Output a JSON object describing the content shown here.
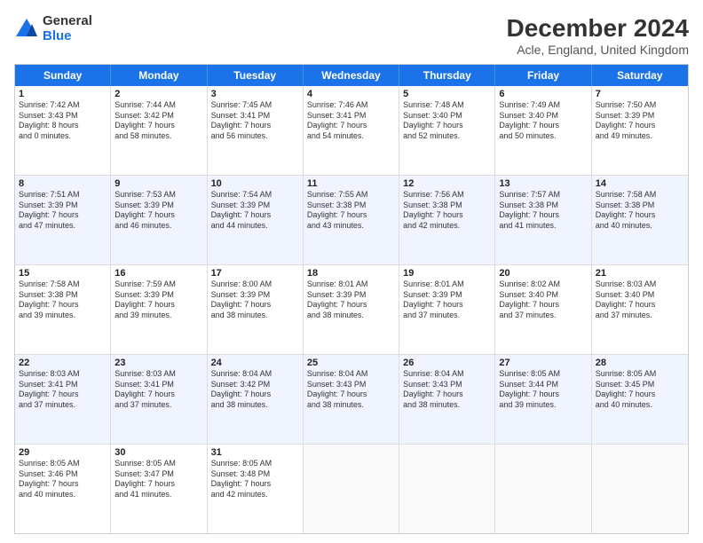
{
  "header": {
    "title": "December 2024",
    "subtitle": "Acle, England, United Kingdom",
    "logo_general": "General",
    "logo_blue": "Blue"
  },
  "days_of_week": [
    "Sunday",
    "Monday",
    "Tuesday",
    "Wednesday",
    "Thursday",
    "Friday",
    "Saturday"
  ],
  "rows": [
    {
      "alt": false,
      "cells": [
        {
          "day": "1",
          "lines": [
            "Sunrise: 7:42 AM",
            "Sunset: 3:43 PM",
            "Daylight: 8 hours",
            "and 0 minutes."
          ]
        },
        {
          "day": "2",
          "lines": [
            "Sunrise: 7:44 AM",
            "Sunset: 3:42 PM",
            "Daylight: 7 hours",
            "and 58 minutes."
          ]
        },
        {
          "day": "3",
          "lines": [
            "Sunrise: 7:45 AM",
            "Sunset: 3:41 PM",
            "Daylight: 7 hours",
            "and 56 minutes."
          ]
        },
        {
          "day": "4",
          "lines": [
            "Sunrise: 7:46 AM",
            "Sunset: 3:41 PM",
            "Daylight: 7 hours",
            "and 54 minutes."
          ]
        },
        {
          "day": "5",
          "lines": [
            "Sunrise: 7:48 AM",
            "Sunset: 3:40 PM",
            "Daylight: 7 hours",
            "and 52 minutes."
          ]
        },
        {
          "day": "6",
          "lines": [
            "Sunrise: 7:49 AM",
            "Sunset: 3:40 PM",
            "Daylight: 7 hours",
            "and 50 minutes."
          ]
        },
        {
          "day": "7",
          "lines": [
            "Sunrise: 7:50 AM",
            "Sunset: 3:39 PM",
            "Daylight: 7 hours",
            "and 49 minutes."
          ]
        }
      ]
    },
    {
      "alt": true,
      "cells": [
        {
          "day": "8",
          "lines": [
            "Sunrise: 7:51 AM",
            "Sunset: 3:39 PM",
            "Daylight: 7 hours",
            "and 47 minutes."
          ]
        },
        {
          "day": "9",
          "lines": [
            "Sunrise: 7:53 AM",
            "Sunset: 3:39 PM",
            "Daylight: 7 hours",
            "and 46 minutes."
          ]
        },
        {
          "day": "10",
          "lines": [
            "Sunrise: 7:54 AM",
            "Sunset: 3:39 PM",
            "Daylight: 7 hours",
            "and 44 minutes."
          ]
        },
        {
          "day": "11",
          "lines": [
            "Sunrise: 7:55 AM",
            "Sunset: 3:38 PM",
            "Daylight: 7 hours",
            "and 43 minutes."
          ]
        },
        {
          "day": "12",
          "lines": [
            "Sunrise: 7:56 AM",
            "Sunset: 3:38 PM",
            "Daylight: 7 hours",
            "and 42 minutes."
          ]
        },
        {
          "day": "13",
          "lines": [
            "Sunrise: 7:57 AM",
            "Sunset: 3:38 PM",
            "Daylight: 7 hours",
            "and 41 minutes."
          ]
        },
        {
          "day": "14",
          "lines": [
            "Sunrise: 7:58 AM",
            "Sunset: 3:38 PM",
            "Daylight: 7 hours",
            "and 40 minutes."
          ]
        }
      ]
    },
    {
      "alt": false,
      "cells": [
        {
          "day": "15",
          "lines": [
            "Sunrise: 7:58 AM",
            "Sunset: 3:38 PM",
            "Daylight: 7 hours",
            "and 39 minutes."
          ]
        },
        {
          "day": "16",
          "lines": [
            "Sunrise: 7:59 AM",
            "Sunset: 3:39 PM",
            "Daylight: 7 hours",
            "and 39 minutes."
          ]
        },
        {
          "day": "17",
          "lines": [
            "Sunrise: 8:00 AM",
            "Sunset: 3:39 PM",
            "Daylight: 7 hours",
            "and 38 minutes."
          ]
        },
        {
          "day": "18",
          "lines": [
            "Sunrise: 8:01 AM",
            "Sunset: 3:39 PM",
            "Daylight: 7 hours",
            "and 38 minutes."
          ]
        },
        {
          "day": "19",
          "lines": [
            "Sunrise: 8:01 AM",
            "Sunset: 3:39 PM",
            "Daylight: 7 hours",
            "and 37 minutes."
          ]
        },
        {
          "day": "20",
          "lines": [
            "Sunrise: 8:02 AM",
            "Sunset: 3:40 PM",
            "Daylight: 7 hours",
            "and 37 minutes."
          ]
        },
        {
          "day": "21",
          "lines": [
            "Sunrise: 8:03 AM",
            "Sunset: 3:40 PM",
            "Daylight: 7 hours",
            "and 37 minutes."
          ]
        }
      ]
    },
    {
      "alt": true,
      "cells": [
        {
          "day": "22",
          "lines": [
            "Sunrise: 8:03 AM",
            "Sunset: 3:41 PM",
            "Daylight: 7 hours",
            "and 37 minutes."
          ]
        },
        {
          "day": "23",
          "lines": [
            "Sunrise: 8:03 AM",
            "Sunset: 3:41 PM",
            "Daylight: 7 hours",
            "and 37 minutes."
          ]
        },
        {
          "day": "24",
          "lines": [
            "Sunrise: 8:04 AM",
            "Sunset: 3:42 PM",
            "Daylight: 7 hours",
            "and 38 minutes."
          ]
        },
        {
          "day": "25",
          "lines": [
            "Sunrise: 8:04 AM",
            "Sunset: 3:43 PM",
            "Daylight: 7 hours",
            "and 38 minutes."
          ]
        },
        {
          "day": "26",
          "lines": [
            "Sunrise: 8:04 AM",
            "Sunset: 3:43 PM",
            "Daylight: 7 hours",
            "and 38 minutes."
          ]
        },
        {
          "day": "27",
          "lines": [
            "Sunrise: 8:05 AM",
            "Sunset: 3:44 PM",
            "Daylight: 7 hours",
            "and 39 minutes."
          ]
        },
        {
          "day": "28",
          "lines": [
            "Sunrise: 8:05 AM",
            "Sunset: 3:45 PM",
            "Daylight: 7 hours",
            "and 40 minutes."
          ]
        }
      ]
    },
    {
      "alt": false,
      "cells": [
        {
          "day": "29",
          "lines": [
            "Sunrise: 8:05 AM",
            "Sunset: 3:46 PM",
            "Daylight: 7 hours",
            "and 40 minutes."
          ]
        },
        {
          "day": "30",
          "lines": [
            "Sunrise: 8:05 AM",
            "Sunset: 3:47 PM",
            "Daylight: 7 hours",
            "and 41 minutes."
          ]
        },
        {
          "day": "31",
          "lines": [
            "Sunrise: 8:05 AM",
            "Sunset: 3:48 PM",
            "Daylight: 7 hours",
            "and 42 minutes."
          ]
        },
        {
          "day": "",
          "lines": []
        },
        {
          "day": "",
          "lines": []
        },
        {
          "day": "",
          "lines": []
        },
        {
          "day": "",
          "lines": []
        }
      ]
    }
  ]
}
